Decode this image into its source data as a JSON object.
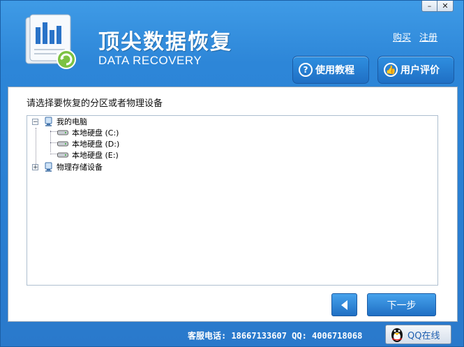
{
  "window": {
    "minimize": "–",
    "close": "✕"
  },
  "header": {
    "title": "顶尖数据恢复",
    "subtitle": "DATA RECOVERY",
    "links": {
      "buy": "购买",
      "register": "注册"
    },
    "tutorial_btn": "使用教程",
    "review_btn": "用户评价",
    "icons": {
      "tutorial": "question-icon",
      "review": "thumbs-up-icon"
    }
  },
  "main": {
    "prompt": "请选择要恢复的分区或者物理设备",
    "tree": {
      "root": {
        "label": "我的电脑",
        "expander": "−"
      },
      "drives": [
        {
          "label": "本地硬盘 (C:)"
        },
        {
          "label": "本地硬盘 (D:)"
        },
        {
          "label": "本地硬盘 (E:)"
        }
      ],
      "physical": {
        "label": "物理存储设备",
        "expander": "+"
      }
    },
    "next_btn": "下一步"
  },
  "footer": {
    "support": "客服电话: 18667133607 QQ: 4006718068",
    "qq_btn": "QQ在线"
  },
  "colors": {
    "bg": "#2a7fd2",
    "button": "#1f6fc4"
  }
}
